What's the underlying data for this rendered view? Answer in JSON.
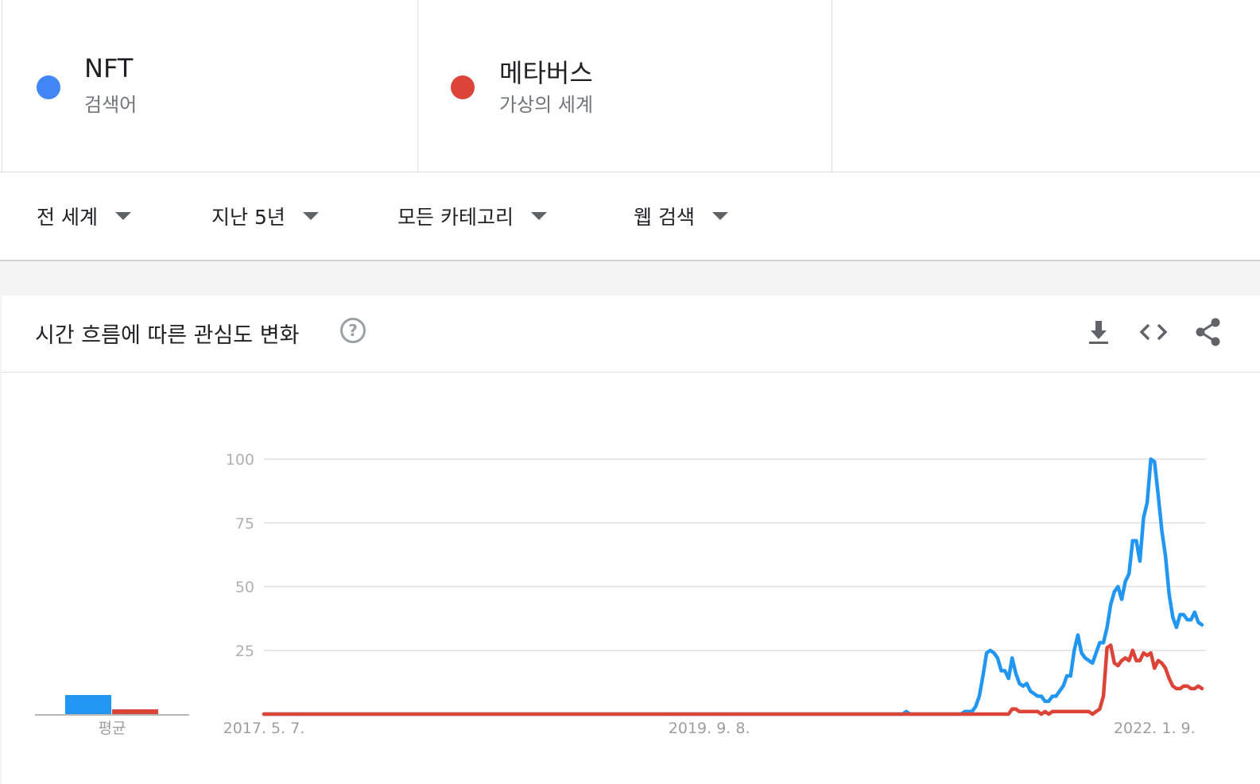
{
  "terms": [
    {
      "name": "NFT",
      "subtitle": "검색어",
      "color": "#4285f4"
    },
    {
      "name": "메타버스",
      "subtitle": "가상의 세계",
      "color": "#db4437"
    }
  ],
  "filters": [
    {
      "label": "전 세계"
    },
    {
      "label": "지난 5년"
    },
    {
      "label": "모든 카테고리"
    },
    {
      "label": "웹 검색"
    }
  ],
  "card": {
    "title": "시간 흐름에 따른 관심도 변화",
    "help_icon": "help-circle-icon",
    "actions": [
      "download-icon",
      "embed-code-icon",
      "share-icon"
    ]
  },
  "chart_data": {
    "type": "line",
    "title": "",
    "xlabel": "",
    "ylabel": "",
    "ylim": [
      0,
      100
    ],
    "yticks": [
      100,
      75,
      50,
      25
    ],
    "x_tick_labels": [
      {
        "label": "2017. 5. 7.",
        "week": 0
      },
      {
        "label": "2019. 9. 8.",
        "week": 122
      },
      {
        "label": "2022. 1. 9.",
        "week": 244
      }
    ],
    "average_label": "평균",
    "x_period": "weekly, 2017-05-07 to 2022-04-24",
    "series": [
      {
        "name": "NFT",
        "color": "#2196f3",
        "average": 8,
        "points": [
          [
            0,
            0
          ],
          [
            175,
            0
          ],
          [
            176,
            1
          ],
          [
            177,
            0
          ],
          [
            191,
            0
          ],
          [
            192,
            1
          ],
          [
            194,
            1
          ],
          [
            195,
            3
          ],
          [
            196,
            7
          ],
          [
            197,
            15
          ],
          [
            198,
            24
          ],
          [
            199,
            25
          ],
          [
            200,
            24
          ],
          [
            201,
            22
          ],
          [
            202,
            17
          ],
          [
            203,
            17
          ],
          [
            204,
            14
          ],
          [
            205,
            22
          ],
          [
            206,
            16
          ],
          [
            207,
            12
          ],
          [
            208,
            11
          ],
          [
            209,
            12
          ],
          [
            210,
            9
          ],
          [
            211,
            8
          ],
          [
            212,
            7
          ],
          [
            213,
            7
          ],
          [
            214,
            5
          ],
          [
            215,
            5
          ],
          [
            216,
            7
          ],
          [
            217,
            7
          ],
          [
            218,
            9
          ],
          [
            219,
            11
          ],
          [
            220,
            15
          ],
          [
            221,
            15
          ],
          [
            222,
            25
          ],
          [
            223,
            31
          ],
          [
            224,
            24
          ],
          [
            225,
            22
          ],
          [
            226,
            21
          ],
          [
            227,
            20
          ],
          [
            228,
            24
          ],
          [
            229,
            28
          ],
          [
            230,
            28
          ],
          [
            231,
            34
          ],
          [
            232,
            43
          ],
          [
            233,
            48
          ],
          [
            234,
            50
          ],
          [
            235,
            45
          ],
          [
            236,
            52
          ],
          [
            237,
            55
          ],
          [
            238,
            68
          ],
          [
            239,
            68
          ],
          [
            240,
            60
          ],
          [
            241,
            77
          ],
          [
            242,
            83
          ],
          [
            243,
            100
          ],
          [
            244,
            99
          ],
          [
            245,
            86
          ],
          [
            246,
            72
          ],
          [
            247,
            62
          ],
          [
            248,
            47
          ],
          [
            249,
            38
          ],
          [
            250,
            34
          ],
          [
            251,
            39
          ],
          [
            252,
            39
          ],
          [
            253,
            37
          ],
          [
            254,
            37
          ],
          [
            255,
            40
          ],
          [
            256,
            36
          ],
          [
            257,
            35
          ]
        ]
      },
      {
        "name": "메타버스",
        "color": "#db4437",
        "average": 2,
        "points": [
          [
            0,
            0
          ],
          [
            204,
            0
          ],
          [
            205,
            2
          ],
          [
            206,
            2
          ],
          [
            207,
            1
          ],
          [
            208,
            1
          ],
          [
            209,
            1
          ],
          [
            212,
            1
          ],
          [
            213,
            0
          ],
          [
            214,
            1
          ],
          [
            215,
            0
          ],
          [
            216,
            1
          ],
          [
            226,
            1
          ],
          [
            227,
            0
          ],
          [
            228,
            1
          ],
          [
            229,
            2
          ],
          [
            230,
            7
          ],
          [
            231,
            26
          ],
          [
            232,
            27
          ],
          [
            233,
            20
          ],
          [
            234,
            19
          ],
          [
            235,
            21
          ],
          [
            236,
            22
          ],
          [
            237,
            21
          ],
          [
            238,
            25
          ],
          [
            239,
            21
          ],
          [
            240,
            21
          ],
          [
            241,
            24
          ],
          [
            242,
            23
          ],
          [
            243,
            24
          ],
          [
            244,
            18
          ],
          [
            245,
            21
          ],
          [
            246,
            20
          ],
          [
            247,
            18
          ],
          [
            248,
            14
          ],
          [
            249,
            11
          ],
          [
            250,
            10
          ],
          [
            251,
            10
          ],
          [
            252,
            11
          ],
          [
            253,
            11
          ],
          [
            254,
            10
          ],
          [
            255,
            10
          ],
          [
            256,
            11
          ],
          [
            257,
            10
          ]
        ]
      }
    ]
  }
}
